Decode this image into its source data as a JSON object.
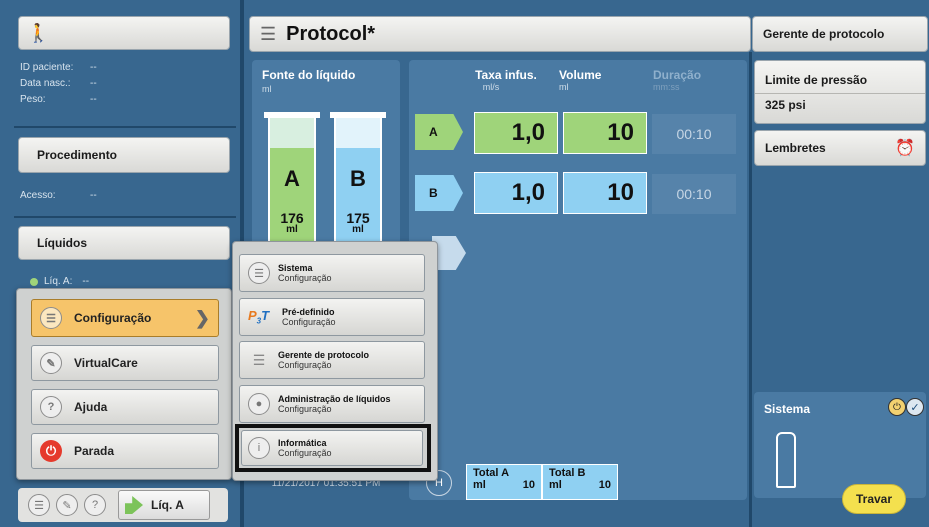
{
  "patient": {
    "id_label": "ID paciente:",
    "id_value": "--",
    "dob_label": "Data nasc.:",
    "dob_value": "--",
    "weight_label": "Peso:",
    "weight_value": "--"
  },
  "left": {
    "procedure_title": "Procedimento",
    "access_label": "Acesso:",
    "access_value": "--",
    "liquids_title": "Líquidos",
    "liq_a_label": "Líq. A:",
    "liq_a_value": "--"
  },
  "header": {
    "title": "Protocol*",
    "right_title": "Gerente de protocolo"
  },
  "fluid": {
    "title": "Fonte do líquido",
    "unit": "ml",
    "a_letter": "A",
    "a_vol": "176",
    "a_unit": "ml",
    "b_letter": "B",
    "b_vol": "175",
    "b_unit": "ml"
  },
  "columns": {
    "rate": "Taxa infus.",
    "rate_unit": "ml/s",
    "volume": "Volume",
    "volume_unit": "ml",
    "duration": "Duração",
    "duration_unit": "mm:ss"
  },
  "phases": [
    {
      "label": "A",
      "rate": "1,0",
      "volume": "10",
      "duration": "00:10"
    },
    {
      "label": "B",
      "rate": "1,0",
      "volume": "10",
      "duration": "00:10"
    }
  ],
  "right": {
    "pressure_title": "Limite de pressão",
    "pressure_value": "325 psi",
    "reminders": "Lembretes",
    "system": "Sistema",
    "lock": "Travar"
  },
  "main_menu": {
    "items": [
      "Configuração",
      "VirtualCare",
      "Ajuda",
      "Parada"
    ]
  },
  "submenu": {
    "items": [
      {
        "title": "Sistema",
        "sub": "Configuração"
      },
      {
        "title": "Pré-definido",
        "sub": "Configuração"
      },
      {
        "title": "Gerente de protocolo",
        "sub": "Configuração"
      },
      {
        "title": "Administração de líquidos",
        "sub": "Configuração"
      },
      {
        "title": "Informática",
        "sub": "Configuração"
      }
    ]
  },
  "footer": {
    "datetime": "11/21/2017 01:35:51 PM",
    "total_a_label": "Total A",
    "total_a_unit": "ml",
    "total_a_value": "10",
    "total_b_label": "Total B",
    "total_b_unit": "ml",
    "total_b_value": "10",
    "liq_button": "Líq. A"
  },
  "colors": {
    "green": "#9fd47a",
    "blue": "#8fd0f2",
    "accent_orange": "#f6c46a",
    "stop_red": "#e53a2c",
    "bg": "#38678f"
  }
}
